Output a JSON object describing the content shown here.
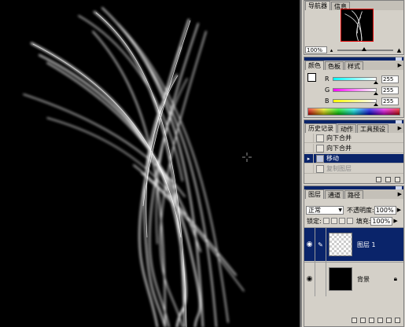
{
  "navigator": {
    "tabs": [
      "导航器",
      "信息"
    ],
    "zoom": "100%"
  },
  "color": {
    "tabs": [
      "颜色",
      "色板",
      "样式"
    ],
    "channels": [
      {
        "label": "R",
        "value": "255",
        "color": "#ff0000"
      },
      {
        "label": "G",
        "value": "255",
        "color": "#00cc00"
      },
      {
        "label": "B",
        "value": "255",
        "color": "#0000ff"
      }
    ]
  },
  "history": {
    "tabs": [
      "历史记录",
      "动作",
      "工具预设"
    ],
    "items": [
      {
        "label": "向下合并"
      },
      {
        "label": "向下合并"
      },
      {
        "label": "移动",
        "selected": true
      },
      {
        "label": "复制图层",
        "dim": true
      }
    ]
  },
  "layers": {
    "tabs": [
      "图层",
      "通道",
      "路径"
    ],
    "blend_mode": "正常",
    "opacity_label": "不透明度:",
    "opacity": "100%",
    "lock_label": "锁定:",
    "fill_label": "填充:",
    "fill": "100%",
    "items": [
      {
        "name": "图层 1",
        "active": true,
        "lock_icon": ""
      },
      {
        "name": "背景",
        "active": false,
        "lock_icon": "lock-icon"
      }
    ]
  },
  "colors": {
    "selection_blue": "#0a246a",
    "panel_gray": "#d4d0c8",
    "canvas_black": "#000000"
  }
}
